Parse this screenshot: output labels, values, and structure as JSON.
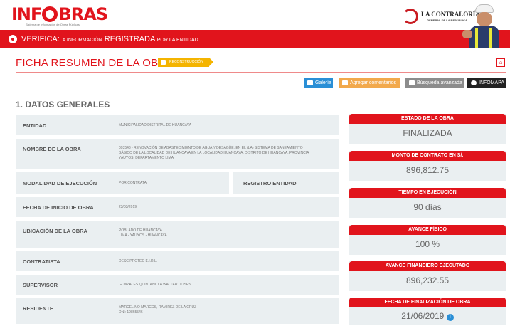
{
  "header": {
    "logo_text_left": "INF",
    "logo_text_right": "BRAS",
    "logo_subtitle": "Sistema de Información de Obras Públicas",
    "org_name": "LA CONTRALORÍA",
    "org_sub": "GENERAL DE LA REPÚBLICA"
  },
  "banner": {
    "verifica": "VERIFICA:",
    "la_informacion": "LA INFORMACIÓN",
    "registrada": "REGISTRADA",
    "por_la_entidad": "POR LA ENTIDAD"
  },
  "page": {
    "title": "FICHA RESUMEN DE LA OBRA",
    "badge": "RECONSTRUCCIÓN",
    "section_title": "1. DATOS GENERALES"
  },
  "toolbar": {
    "galeria": "Galería",
    "comentarios": "Agregar comentarios",
    "busqueda": "Búsqueda avanzada",
    "infomapa": "INFOMAPA"
  },
  "fields": {
    "entidad": {
      "label": "ENTIDAD",
      "value": "MUNICIPALIDAD DISTRITAL DE HUANCAYA"
    },
    "nombre": {
      "label": "NOMBRE DE LA OBRA",
      "value": "093548 - RENOVACIÓN DE ABASTECIMIENTO DE AGUA Y DESAGÜE; EN EL (LA) SISTEMA DE SANEAMIENTO\nBÁSICO DE LA LOCALIDAD DE HUANCAYA EN LA LOCALIDAD HUANCAYA, DISTRITO DE HUANCAYA, PROVINCIA\nYAUYOS, DEPARTAMENTO LIMA"
    },
    "modalidad": {
      "label": "MODALIDAD DE EJECUCIÓN",
      "value": "POR CONTRATA"
    },
    "registro": {
      "label": "REGISTRO ENTIDAD"
    },
    "fecha_inicio": {
      "label": "FECHA DE INICIO DE OBRA",
      "value": "23/03/2019"
    },
    "ubicacion": {
      "label": "UBICACIÓN DE LA OBRA",
      "value": "POBLADO DE HUANCAYA\nLIMA - YAUYOS - HUANCAYA"
    },
    "contratista": {
      "label": "CONTRATISTA",
      "value": "DESCIPROTEC E.I.R.L."
    },
    "supervisor": {
      "label": "SUPERVISOR",
      "value": "GONZALES QUINTANILLA WALTER ULISES"
    },
    "residente": {
      "label": "RESIDENTE",
      "value": "MARCELINO MARCOS, RAMIREZ DE LA CRUZ\nDNI: 19865546"
    }
  },
  "stats": {
    "estado": {
      "label": "ESTADO DE LA OBRA",
      "value": "FINALIZADA"
    },
    "monto": {
      "label": "MONTO DE CONTRATO EN S/.",
      "value": "896,812.75"
    },
    "tiempo": {
      "label": "TIEMPO EN EJECUCIÓN",
      "value": "90 días"
    },
    "avance_fisico": {
      "label": "AVANCE FÍSICO",
      "value": "100 %"
    },
    "avance_financiero": {
      "label": "AVANCE FINANCIERO EJECUTADO",
      "value": "896,232.55"
    },
    "fecha_fin": {
      "label": "FECHA DE FINALIZACIÓN DE OBRA",
      "value": "21/06/2019"
    }
  },
  "colors": {
    "brand_red": "#e1141c",
    "accent_orange": "#f4b400",
    "gallery_blue": "#2a8fd6",
    "panel_gray": "#eaeff1"
  }
}
